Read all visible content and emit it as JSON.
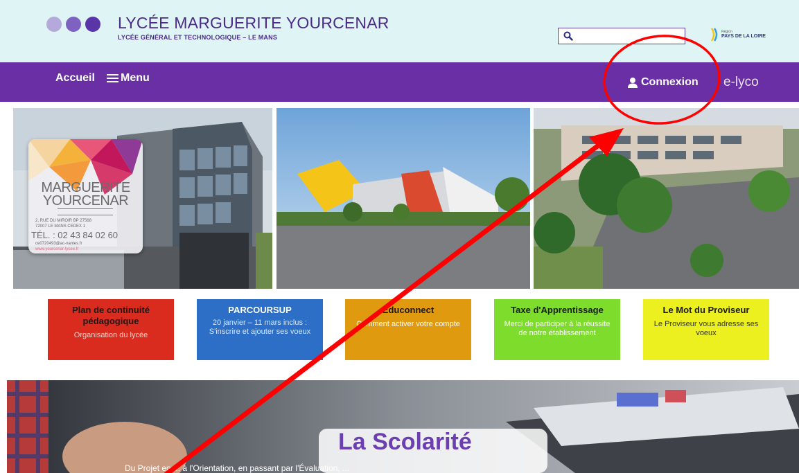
{
  "header": {
    "school_name": "LYCÉE MARGUERITE YOURCENAR",
    "school_type": "LYCÉE GÉNÉRAL ET TECHNOLOGIQUE – LE MANS",
    "dots_colors": [
      "#b5a8da",
      "#7d62c2",
      "#5a35a8"
    ],
    "search": {
      "value": "",
      "placeholder": ""
    },
    "region_logo": {
      "small": "Région",
      "big": "PAYS DE LA LOIRE"
    }
  },
  "nav": {
    "home_label": "Accueil",
    "menu_label": "Menu",
    "login_label": "Connexion",
    "elyco_label": "e-lyco"
  },
  "photo_card": {
    "name_line1": "MARGUERITE",
    "name_line2": "YOURCENAR",
    "address_line1": "2, RUE DU MIROIR BP 27568",
    "address_line2": "72007 LE MANS CEDEX 1",
    "phone": "TÉL. : 02 43 84 02 60",
    "email": "ce0720493@ac-nantes.fr",
    "website": "www.yourcenar-lycee.fr"
  },
  "tiles": [
    {
      "title": "Plan de continuité pédagogique",
      "desc": "Organisation du lycée",
      "bg": "#d92b1e",
      "title_color": "#1a1a1a",
      "desc_color": "#ffd0c8"
    },
    {
      "title": "PARCOURSUP",
      "desc": "20 janvier – 11 mars inclus : S'inscrire et ajouter ses voeux",
      "bg": "#2d6fc6",
      "title_color": "#ffffff",
      "desc_color": "#d8e8ff"
    },
    {
      "title": "Educonnect",
      "desc": "Comment activer votre compte",
      "bg": "#e09a10",
      "title_color": "#1a1a1a",
      "desc_color": "#ffffff"
    },
    {
      "title": "Taxe d'Apprentissage",
      "desc": "Merci de participer à la réussite de notre établissement",
      "bg": "#7ddc2c",
      "title_color": "#1a1a1a",
      "desc_color": "#ffffff"
    },
    {
      "title": "Le Mot du Proviseur",
      "desc": "Le Proviseur vous adresse ses voeux",
      "bg": "#ecf01e",
      "title_color": "#1a1a1a",
      "desc_color": "#333333"
    }
  ],
  "banner": {
    "title": "La Scolarité",
    "text": "Du Projet en ... à l'Orientation, en passant par l'Évaluation, ..."
  },
  "annotation": {
    "circle_color": "#ff0000",
    "arrow_color": "#ff0000"
  }
}
